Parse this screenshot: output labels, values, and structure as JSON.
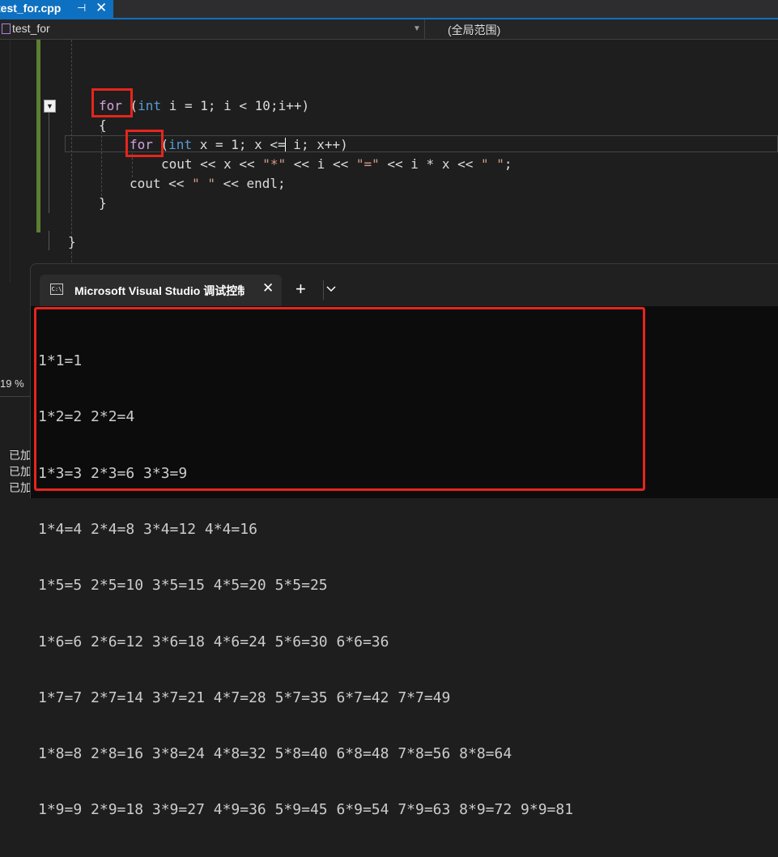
{
  "tab": {
    "filename": "test_for.cpp",
    "pin_icon": "pin-icon",
    "close_glyph": "✕"
  },
  "navbar": {
    "scope_left": "test_for",
    "scope_right": "(全局范围)"
  },
  "code": {
    "line1": {
      "kw": "for",
      "rest_a": " (",
      "type": "int",
      "rest_b": " i = 1; i < 10;i++)"
    },
    "line2": "{",
    "line3": {
      "kw": "for",
      "rest_a": " (",
      "type": "int",
      "rest_b": " x = 1; x <= i; x++)"
    },
    "line4": {
      "p1": "cout << x << ",
      "s1": "\"*\"",
      "p2": " << i << ",
      "s2": "\"=\"",
      "p3": " << i * x << ",
      "s3": "\" \"",
      "p4": ";"
    },
    "line5": {
      "p1": "cout << ",
      "s1": "\" \"",
      "p2": " << endl;"
    },
    "line6": "}",
    "line7": "}"
  },
  "left_panel": {
    "zoom": "19 %",
    "output_lines": [
      "已加",
      "已加",
      "已加"
    ]
  },
  "terminal": {
    "tab_title": "Microsoft Visual Studio 调试控制台",
    "close_glyph": "✕",
    "plus_glyph": "+",
    "chevron_glyph": "⌄",
    "output": [
      "1*1=1",
      "1*2=2 2*2=4",
      "1*3=3 2*3=6 3*3=9",
      "1*4=4 2*4=8 3*4=12 4*4=16",
      "1*5=5 2*5=10 3*5=15 4*5=20 5*5=25",
      "1*6=6 2*6=12 3*6=18 4*6=24 5*6=30 6*6=36",
      "1*7=7 2*7=14 3*7=21 4*7=28 5*7=35 6*7=42 7*7=49",
      "1*8=8 2*8=16 3*8=24 4*8=32 5*8=40 6*8=48 7*8=56 8*8=64",
      "1*9=9 2*9=18 3*9=27 4*9=36 5*9=45 6*9=54 7*9=63 8*9=72 9*9=81"
    ]
  },
  "colors": {
    "accent": "#0e70c0",
    "highlight_box": "#e5251d",
    "keyword": "#d8a0df",
    "type": "#569cd6"
  }
}
